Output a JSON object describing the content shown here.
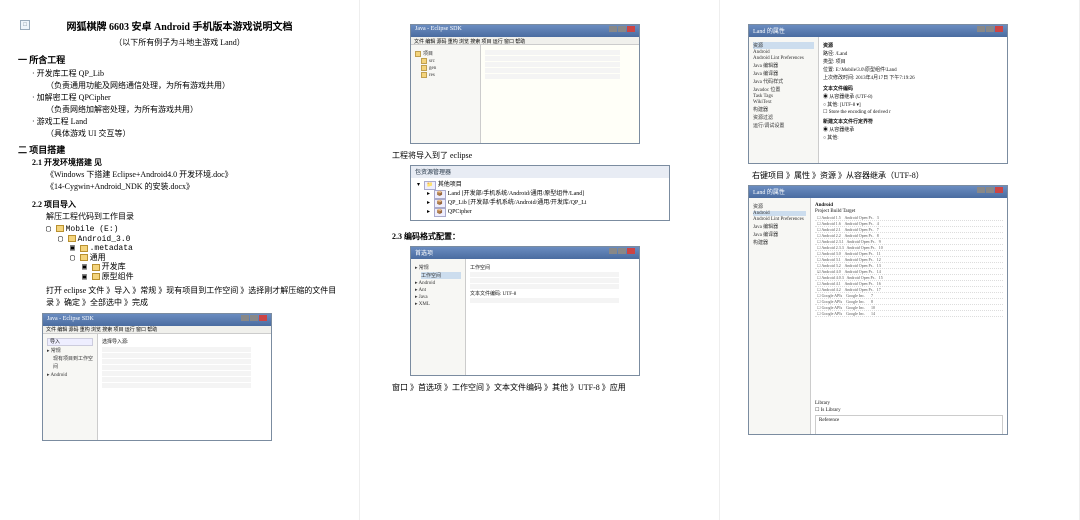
{
  "doc": {
    "title": "网狐棋牌 6603 安卓 Android 手机版本游戏说明文档",
    "subtitle": "（以下所有例子为斗地主游戏 Land）"
  },
  "s1": {
    "heading": "一 所含工程",
    "lib": "· 开发库工程  QP_Lib",
    "lib_desc": "（负责通用功能及网络通信处理，为所有游戏共用）",
    "cipher": "· 加解密工程  QPCipher",
    "cipher_desc": "（负责网络加解密处理，为所有游戏共用）",
    "game": "· 游戏工程    Land",
    "game_desc": "（具体游戏 UI 交互等）"
  },
  "s2": {
    "heading": "二 项目搭建",
    "s21": "2.1 开发环境搭建 见",
    "ref1": "《Windows 下搭建 Eclipse+Android4.0 开发环境.doc》",
    "ref2": "《14-Cygwin+Android_NDK 的安装.docx》",
    "s22": "2.2 项目导入",
    "step1": "解压工程代码到工作目录",
    "import_text": "打开 eclipse 文件 》导入 》常规 》现有项目到工作空间 》选择刚才解压缩的文件目录 》确定 》全部选中 》完成"
  },
  "tree": {
    "n1": "Mobile (E:)",
    "n2": "Android_3.0",
    "n3": ".metadata",
    "n4": "通用",
    "n5": "开发库",
    "n6": "原型组件"
  },
  "ss1": {
    "title": "Java - Eclipse SDK",
    "import_dialog": "导入",
    "left1": "常规",
    "left2": "Android",
    "right1": "选择导入源:",
    "right2": "现有项目到工作空间"
  },
  "p2": {
    "after_import": "工程将导入到了 eclipse",
    "pkg_title": "包资源管理器",
    "pkg1": "其他项目",
    "pkg2": "Land [开发部/手机系统/Android/通用/原型组件/Land]",
    "pkg3": "QP_Lib [开发部/手机系统/Android/通用/开发库/QP_Li",
    "pkg4": "QPCipher",
    "s23": "2.3 编码格式配置：",
    "prefs_title": "首选项",
    "path_text": "窗口 》首选项 》工作空间 》文本文件编码 》其他 》UTF-8 》应用"
  },
  "p3": {
    "ctx_path": "右键项目 》属性 》资源 》从容器继承（UTF-8）",
    "prop_title": "Land 的属性",
    "prop_panel_head": "资源",
    "row_path_lbl": "路径:",
    "row_path": "/Land",
    "row_type_lbl": "类型:",
    "row_type": "项目",
    "row_loc_lbl": "位置:",
    "row_loc": "E:\\Mobile\\3.0\\原型组件\\Land",
    "row_mod_lbl": "上次修改时间:",
    "row_mod": "2013年4月17日 下午7:19:26",
    "enc_head": "文本文件编码",
    "enc_inherit": "从容器继承 (UTF-8)",
    "enc_other": "其他:",
    "enc_store": "Store the encoding of derived r",
    "delim_head": "新建文本文件行定界符",
    "delim_inherit": "从容器继承",
    "delim_other": "其他:",
    "left_items": [
      "资源",
      "Android",
      "Android Lint Preferences",
      "Java 编辑器",
      "Java 编译器",
      "Java 代码样式",
      "Javadoc 位置",
      "Task Tags",
      "WikiText",
      "构建器",
      "资源过滤",
      "运行/调试设置"
    ],
    "big_title": "Android",
    "big_col": "Project Build Target"
  }
}
